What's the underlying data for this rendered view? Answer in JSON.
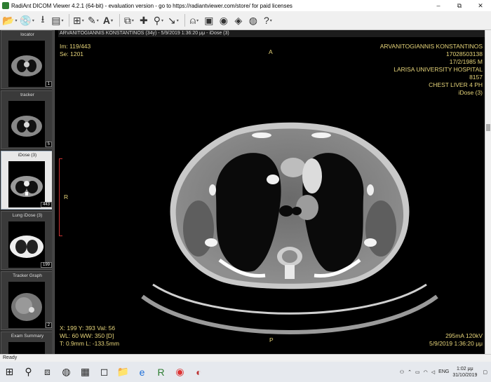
{
  "window": {
    "title": "RadiAnt DICOM Viewer 4.2.1 (64-bit) - evaluation version - go to https://radiantviewer.com/store/ for paid licenses",
    "minimize": "–",
    "maximize": "⧉",
    "close": "✕"
  },
  "toolbar": {
    "items": [
      "open-folder-icon",
      "cd-icon",
      "download-icon",
      "save-icon",
      "layout-icon",
      "pen-icon",
      "text-icon",
      "crosshair-icon",
      "probe-icon",
      "series-icon",
      "ruler-icon",
      "reference-icon",
      "screenshot-icon",
      "mpr-icon",
      "3d-icon",
      "fusion-icon",
      "help-icon"
    ]
  },
  "series_list": [
    {
      "label": "locator",
      "count": "1",
      "active": false
    },
    {
      "label": "tracker",
      "count": "5",
      "active": false
    },
    {
      "label": "iDose (3)",
      "count": "443",
      "active": true
    },
    {
      "label": "Lung  iDose (3)",
      "count": "199",
      "active": false
    },
    {
      "label": "Tracker Graph",
      "count": "2",
      "active": false
    },
    {
      "label": "Exam Summary",
      "count": "",
      "active": false
    }
  ],
  "viewer": {
    "header": "ARVANITOGIANNIS KONSTANTINOS (34y) - 5/9/2019 1:36:20 μμ - iDose (3)",
    "top_left": [
      "Im: 119/443",
      "Se: 1201"
    ],
    "top_right": [
      "ARVANITOGIANNIS KONSTANTINOS",
      "17028503138",
      "17/2/1985 M",
      "LARISA UNIVERSITY HOSPITAL",
      "8157",
      "CHEST LIVER 4 PH",
      "iDose (3)"
    ],
    "orient_top": "A",
    "orient_left": "R",
    "orient_bottom": "P",
    "bottom_left": [
      "X: 199 Y: 393 Val: 56",
      "WL: 60 WW: 350 [D]",
      "T: 0.9mm L: -133.5mm"
    ],
    "bottom_right": [
      "295mA 120kV",
      "5/9/2019 1:36:20 μμ"
    ]
  },
  "status": {
    "text": "Ready"
  },
  "taskbar": {
    "language": "ENG",
    "time": "1:02 μμ",
    "date": "31/10/2019"
  }
}
